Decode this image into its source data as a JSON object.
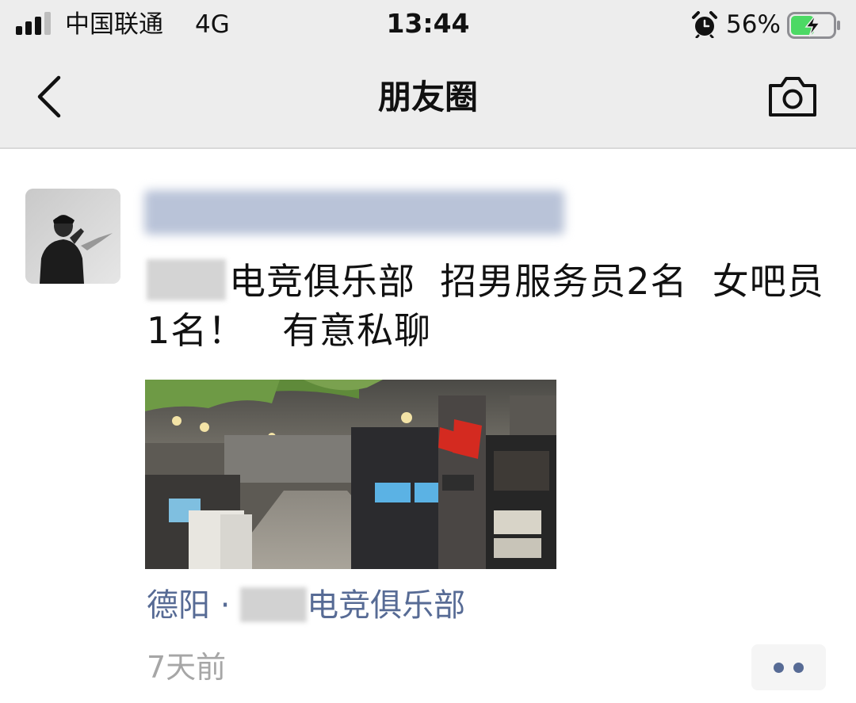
{
  "status_bar": {
    "carrier": "中国联通",
    "network": "4G",
    "time": "13:44",
    "battery_percent": "56%",
    "battery_level": 0.56,
    "charging": true
  },
  "nav": {
    "title": "朋友圈"
  },
  "post": {
    "text_after_blur": "电竞俱乐部  招男服务员2名  女吧员1名！   有意私聊",
    "location_prefix": "德阳 · ",
    "location_suffix": "电竞俱乐部",
    "time_ago": "7天前"
  },
  "colors": {
    "link": "#576b95",
    "nav_background": "#ededed",
    "battery_green": "#4cd964"
  },
  "icons": {
    "back": "chevron-left-icon",
    "camera": "camera-icon",
    "alarm": "alarm-clock-icon",
    "more": "more-dots-icon"
  }
}
